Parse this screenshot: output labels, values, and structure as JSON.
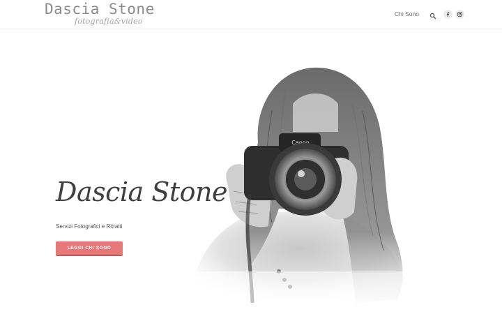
{
  "header": {
    "logo_title": "Dascia Stone",
    "logo_subtitle": "fotografia&video",
    "nav": [
      {
        "label": "Chi Sono"
      }
    ],
    "icons": [
      "search-icon",
      "facebook-icon",
      "instagram-icon"
    ]
  },
  "hero": {
    "title": "Dascia Stone",
    "subtitle": "Servizi Fotografici e Ritratti",
    "cta_label": "LEGGI CHI SONO",
    "image": "woman-with-camera-portrait"
  },
  "colors": {
    "accent": "#e7787a",
    "accent_dark": "#c85a5c",
    "logo_text": "#8c8c8c",
    "title_text": "#3f3f3f"
  }
}
